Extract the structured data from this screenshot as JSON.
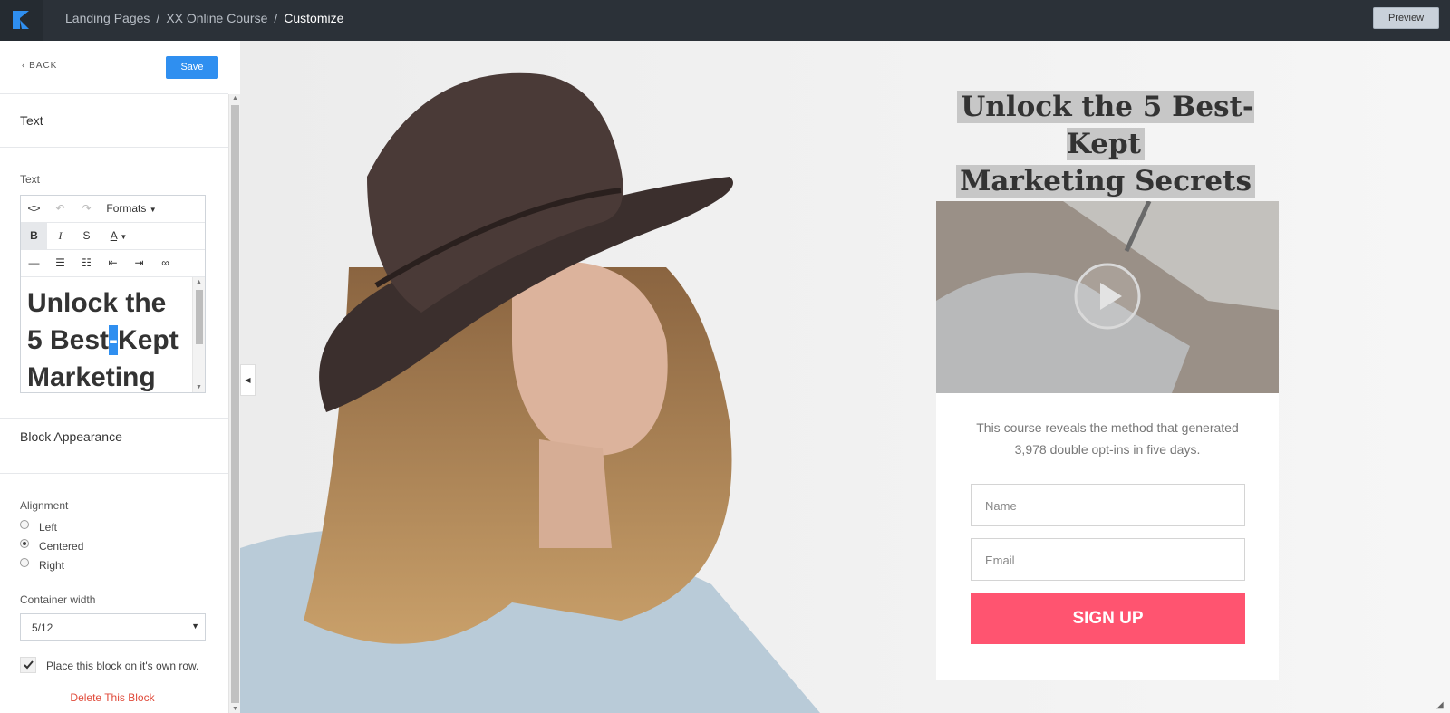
{
  "topbar": {
    "breadcrumb": [
      "Landing Pages",
      "XX Online Course",
      "Customize"
    ],
    "separator": "/",
    "preview_label": "Preview"
  },
  "panel": {
    "back_label": "BACK",
    "save_label": "Save",
    "section_text": "Text",
    "text_field_label": "Text",
    "toolbar": {
      "formats_label": "Formats"
    },
    "editor_text": {
      "line1": "Unlock the",
      "line2_before": "5 Best",
      "line2_selected": "-",
      "line2_after": "Kept",
      "line3": "Marketing"
    },
    "block_appearance": "Block Appearance",
    "alignment_label": "Alignment",
    "alignment_options": [
      "Left",
      "Centered",
      "Right"
    ],
    "alignment_selected": "Centered",
    "container_width_label": "Container width",
    "container_width_value": "5/12",
    "own_row_label": "Place this block on it's own row.",
    "own_row_checked": true,
    "delete_label": "Delete This Block"
  },
  "page": {
    "headline_line1": "Unlock the 5 Best-Kept",
    "headline_line2": "Marketing Secrets",
    "description_line1": "This course reveals the method that generated",
    "description_line2": "3,978 double opt-ins in five days.",
    "name_placeholder": "Name",
    "email_placeholder": "Email",
    "signup_label": "SIGN UP"
  },
  "colors": {
    "topbar": "#2b3138",
    "accent": "#2f8ff0",
    "signup": "#ff5470",
    "delete": "#e04a3a"
  }
}
